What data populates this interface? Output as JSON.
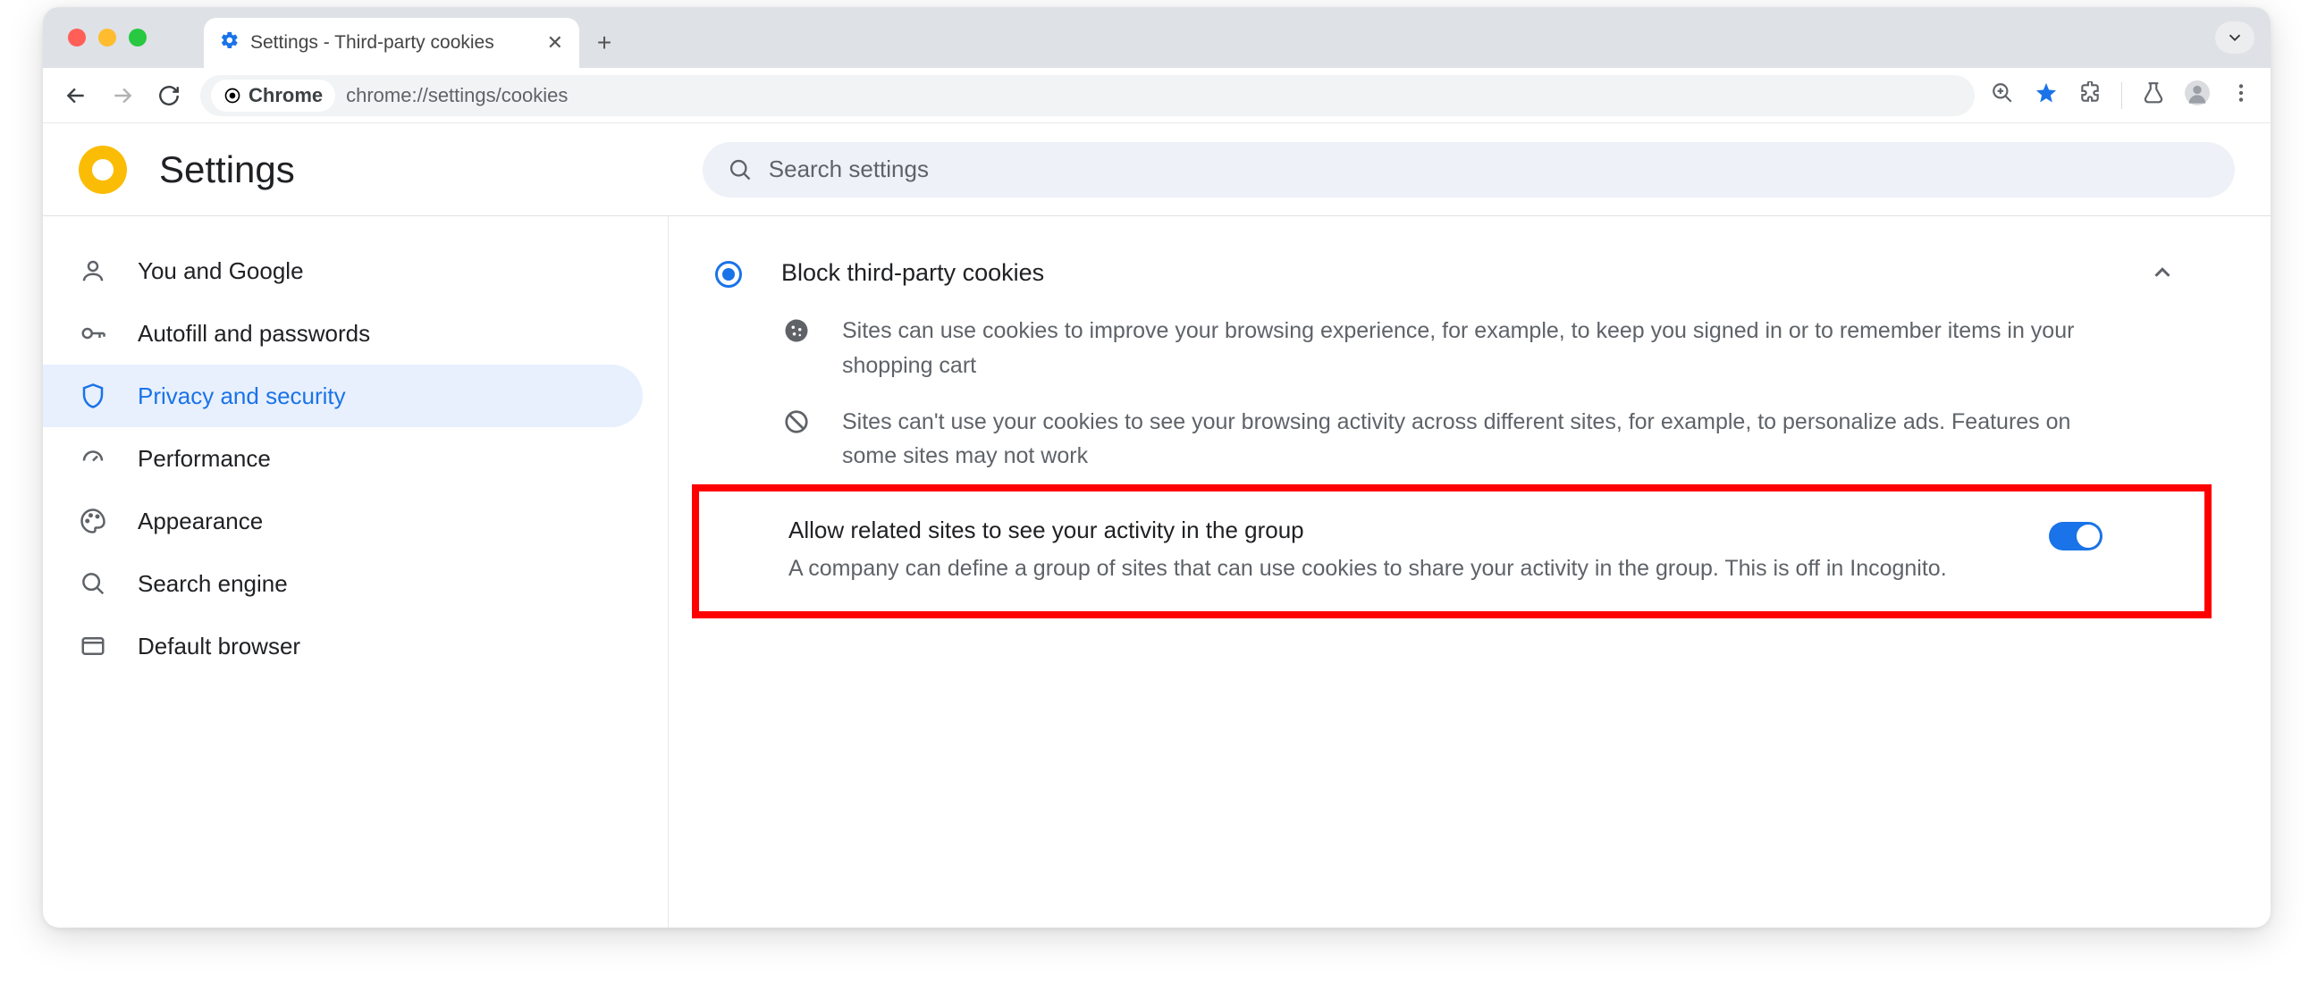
{
  "tab": {
    "title": "Settings - Third-party cookies"
  },
  "omnibox": {
    "chip": "Chrome",
    "url": "chrome://settings/cookies"
  },
  "header": {
    "title": "Settings",
    "search_placeholder": "Search settings"
  },
  "sidebar": {
    "items": [
      {
        "label": "You and Google"
      },
      {
        "label": "Autofill and passwords"
      },
      {
        "label": "Privacy and security"
      },
      {
        "label": "Performance"
      },
      {
        "label": "Appearance"
      },
      {
        "label": "Search engine"
      },
      {
        "label": "Default browser"
      }
    ]
  },
  "content": {
    "option_title": "Block third-party cookies",
    "desc1": "Sites can use cookies to improve your browsing experience, for example, to keep you signed in or to remember items in your shopping cart",
    "desc2": "Sites can't use your cookies to see your browsing activity across different sites, for example, to personalize ads. Features on some sites may not work",
    "toggle_title": "Allow related sites to see your activity in the group",
    "toggle_sub": "A company can define a group of sites that can use cookies to share your activity in the group. This is off in Incognito."
  }
}
